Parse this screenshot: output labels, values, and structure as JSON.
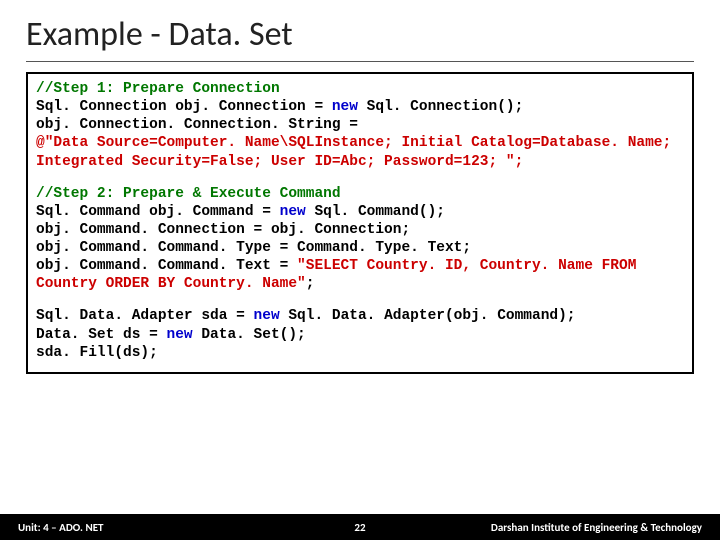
{
  "title": "Example - Data. Set",
  "code": {
    "step1": {
      "comment": "//Step 1: Prepare Connection",
      "l1a": "Sql. Connection obj. Connection = ",
      "l1new": "new",
      "l1b": " Sql. Connection();",
      "l2": "obj. Connection. Connection. String =",
      "l3": "@\"Data Source=Computer. Name\\SQLInstance; Initial Catalog=Database. Name; Integrated Security=False; User ID=Abc; Password=123; \";"
    },
    "step2": {
      "comment": "//Step 2: Prepare & Execute Command",
      "l1a": "Sql. Command obj. Command = ",
      "l1new": "new",
      "l1b": " Sql. Command();",
      "l2": "obj. Command. Connection = obj. Connection;",
      "l3": "obj. Command. Command. Type = Command. Type. Text;",
      "l4a": "obj. Command. Command. Text = ",
      "l4b": "\"SELECT Country. ID, Country. Name FROM Country ORDER BY Country. Name\"",
      "l4c": ";"
    },
    "step3": {
      "l1a": "Sql. Data. Adapter sda = ",
      "l1new": "new",
      "l1b": " Sql. Data. Adapter(obj. Command);",
      "l2a": "Data. Set ds = ",
      "l2new": "new",
      "l2b": " Data. Set();",
      "l3": "sda. Fill(ds);"
    }
  },
  "footer": {
    "left": "Unit: 4 – ADO. NET",
    "center": "22",
    "right": "Darshan Institute of Engineering & Technology"
  }
}
